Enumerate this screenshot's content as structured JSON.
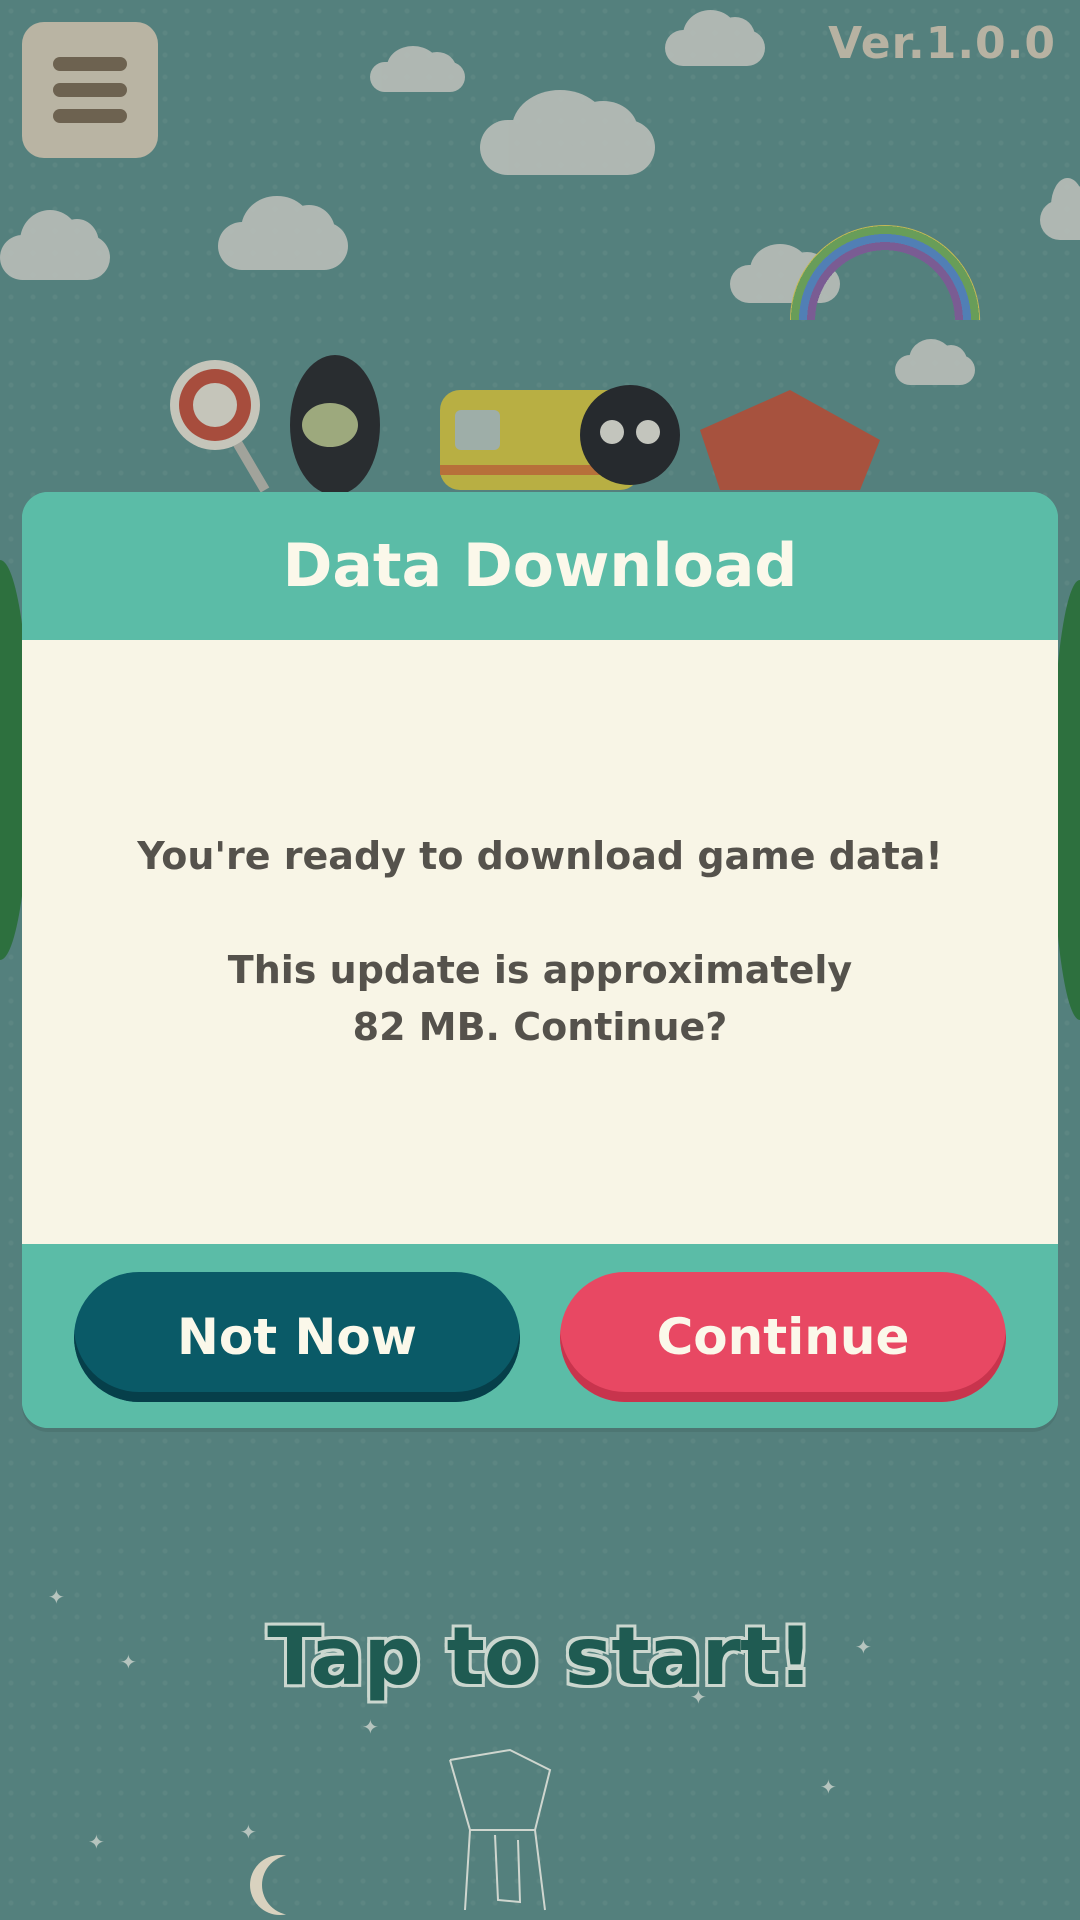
{
  "header": {
    "version": "Ver.1.0.0"
  },
  "dialog": {
    "title": "Data Download",
    "message_line1": "You're ready to download game data!",
    "message_line2": "This update is approximately",
    "message_line3": "82 MB. Continue?",
    "not_now_label": "Not Now",
    "continue_label": "Continue"
  },
  "footer": {
    "tap_to_start": "Tap to start!"
  },
  "colors": {
    "dialog_header": "#5bbca7",
    "dialog_body": "#f8f5e6",
    "not_now_button": "#0a5a67",
    "continue_button": "#e84863",
    "background": "#5f8f8b"
  }
}
